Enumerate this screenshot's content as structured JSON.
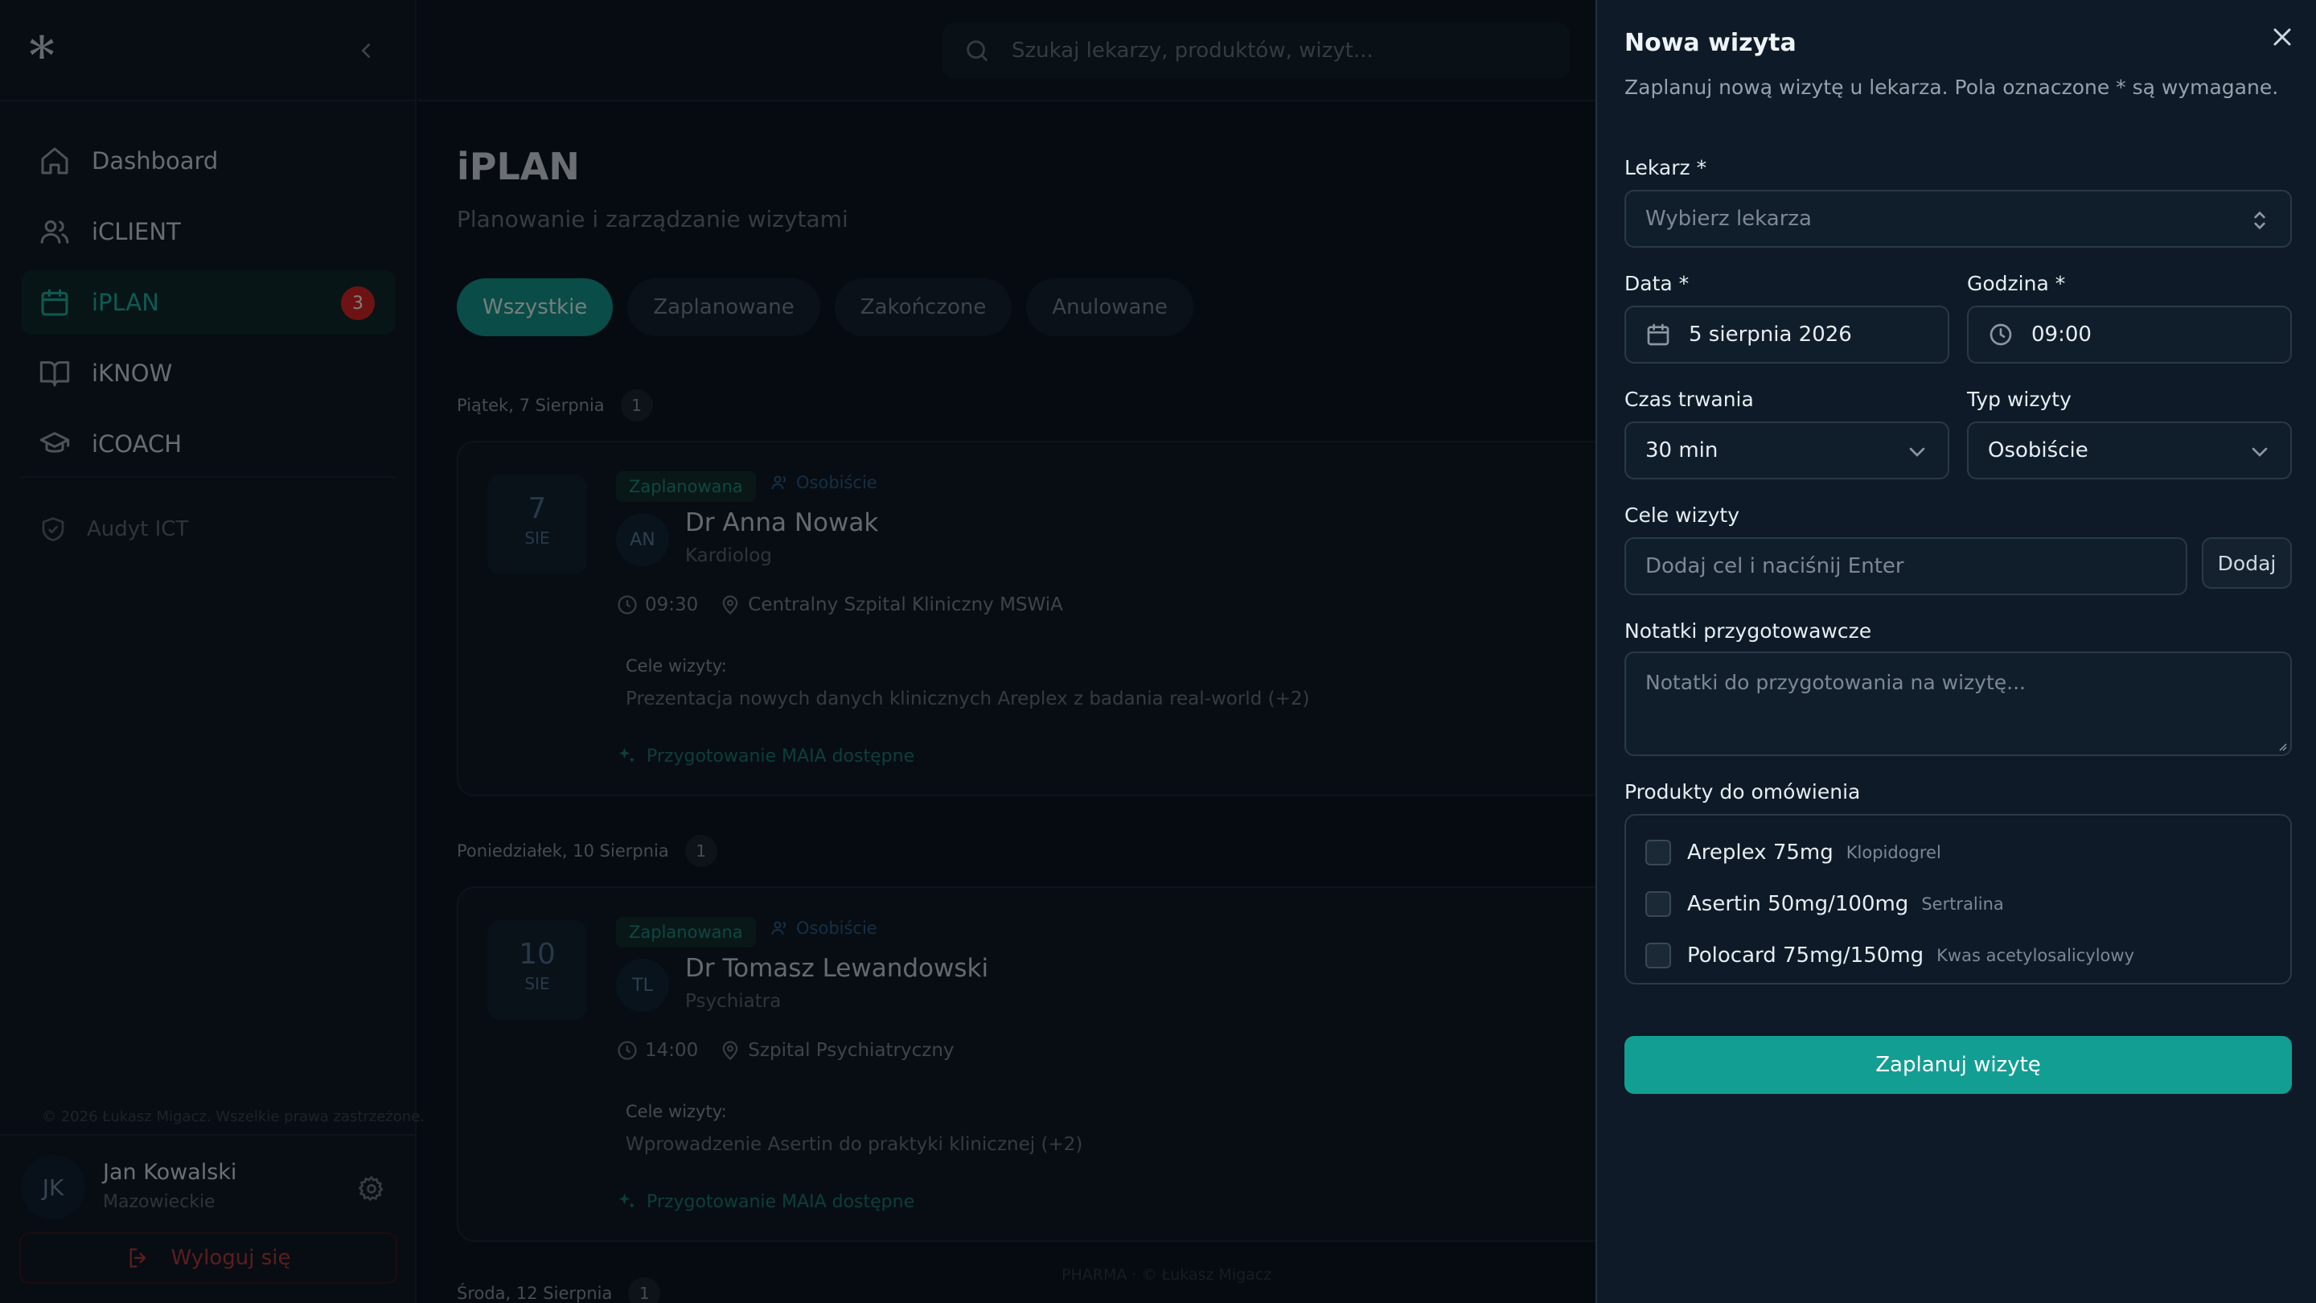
{
  "sidebar": {
    "items": [
      {
        "label": "Dashboard",
        "icon": "home-icon"
      },
      {
        "label": "iCLIENT",
        "icon": "users-icon"
      },
      {
        "label": "iPLAN",
        "icon": "calendar-icon",
        "badge": "3",
        "active": true
      },
      {
        "label": "iKNOW",
        "icon": "book-icon"
      },
      {
        "label": "iCOACH",
        "icon": "graduation-cap-icon"
      }
    ],
    "audit_label": "Audyt ICT",
    "copyright": "© 2026 Łukasz Migacz. Wszelkie prawa zastrzeżone.",
    "user": {
      "initials": "JK",
      "name": "Jan Kowalski",
      "region": "Mazowieckie"
    },
    "logout_label": "Wyloguj się"
  },
  "topbar": {
    "search_placeholder": "Szukaj lekarzy, produktów, wizyt..."
  },
  "main": {
    "title": "iPLAN",
    "subtitle": "Planowanie i zarządzanie wizytami",
    "filters": [
      "Wszystkie",
      "Zaplanowane",
      "Zakończone",
      "Anulowane"
    ],
    "days": [
      {
        "label": "Piątek, 7 Sierpnia",
        "count": "1",
        "visit": {
          "day": "7",
          "month": "SIE",
          "status": "Zaplanowana",
          "type": "Osobiście",
          "initials": "AN",
          "doctor": "Dr Anna Nowak",
          "specialty": "Kardiolog",
          "time": "09:30",
          "place": "Centralny Szpital Kliniczny MSWiA",
          "goals_label": "Cele wizyty:",
          "goals": "Prezentacja nowych danych klinicznych Areplex z badania real-world (+2)",
          "maia": "Przygotowanie MAIA dostępne"
        }
      },
      {
        "label": "Poniedziałek, 10 Sierpnia",
        "count": "1",
        "visit": {
          "day": "10",
          "month": "SIE",
          "status": "Zaplanowana",
          "type": "Osobiście",
          "initials": "TL",
          "doctor": "Dr Tomasz Lewandowski",
          "specialty": "Psychiatra",
          "time": "14:00",
          "place": "Szpital Psychiatryczny",
          "goals_label": "Cele wizyty:",
          "goals": "Wprowadzenie Asertin do praktyki klinicznej (+2)",
          "maia": "Przygotowanie MAIA dostępne"
        }
      },
      {
        "label": "Środa, 12 Sierpnia",
        "count": "1"
      }
    ],
    "footer": "PHARMA · © Łukasz Migacz"
  },
  "modal": {
    "title": "Nowa wizyta",
    "description": "Zaplanuj nową wizytę u lekarza. Pola oznaczone * są wymagane.",
    "doctor_label": "Lekarz *",
    "doctor_placeholder": "Wybierz lekarza",
    "date_label": "Data *",
    "date_value": "5 sierpnia 2026",
    "time_label": "Godzina *",
    "time_value": "09:00",
    "duration_label": "Czas trwania",
    "duration_value": "30 min",
    "type_label": "Typ wizyty",
    "type_value": "Osobiście",
    "goals_label": "Cele wizyty",
    "goals_placeholder": "Dodaj cel i naciśnij Enter",
    "add_label": "Dodaj",
    "notes_label": "Notatki przygotowawcze",
    "notes_placeholder": "Notatki do przygotowania na wizytę...",
    "products_label": "Produkty do omówienia",
    "products": [
      {
        "name": "Areplex 75mg",
        "substance": "Klopidogrel",
        "checked": false
      },
      {
        "name": "Asertin 50mg/100mg",
        "substance": "Sertralina",
        "checked": false
      },
      {
        "name": "Polocard 75mg/150mg",
        "substance": "Kwas acetylosalicylowy",
        "checked": false
      }
    ],
    "submit_label": "Zaplanuj wizytę"
  },
  "colors": {
    "accent": "#139e93",
    "badge": "#dc2626",
    "background": "#0b1622"
  }
}
